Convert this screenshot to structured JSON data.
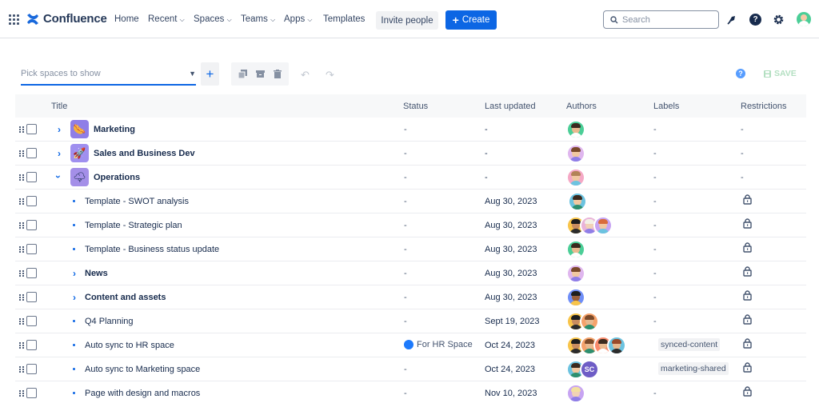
{
  "nav": {
    "app_name": "Confluence",
    "items": [
      {
        "label": "Home",
        "dropdown": false
      },
      {
        "label": "Recent",
        "dropdown": true
      },
      {
        "label": "Spaces",
        "dropdown": true
      },
      {
        "label": "Teams",
        "dropdown": true
      },
      {
        "label": "Apps",
        "dropdown": true
      },
      {
        "label": "Templates",
        "dropdown": false
      }
    ],
    "invite_label": "Invite people",
    "create_label": "Create",
    "search_placeholder": "Search",
    "icons": [
      "notification-icon",
      "help-icon",
      "settings-icon",
      "profile-avatar"
    ]
  },
  "toolbar": {
    "picker_placeholder": "Pick spaces to show",
    "save_label": "SAVE",
    "icons": [
      "add-icon",
      "copy-icon",
      "archive-icon",
      "trash-icon",
      "undo-icon",
      "redo-icon",
      "help-icon",
      "save-icon"
    ]
  },
  "table": {
    "columns": [
      "Title",
      "Status",
      "Last updated",
      "Authors",
      "Labels",
      "Restrictions"
    ],
    "rows": [
      {
        "title": "Marketing",
        "status": "-",
        "updated": "-",
        "labels": "-",
        "restrictions": "-"
      },
      {
        "title": "Sales and Business Dev",
        "status": "-",
        "updated": "-",
        "labels": "-",
        "restrictions": "-"
      },
      {
        "title": "Operations",
        "status": "-",
        "updated": "-",
        "labels": "-",
        "restrictions": "-"
      },
      {
        "title": "Template - SWOT analysis",
        "status": "-",
        "updated": "Aug 30, 2023",
        "labels": "-"
      },
      {
        "title": "Template - Strategic plan",
        "status": "-",
        "updated": "Aug 30, 2023",
        "labels": "-"
      },
      {
        "title": "Template - Business status update",
        "status": "-",
        "updated": "Aug 30, 2023",
        "labels": "-"
      },
      {
        "title": "News",
        "status": "-",
        "updated": "Aug 30, 2023",
        "labels": "-"
      },
      {
        "title": "Content and assets",
        "status": "-",
        "updated": "Aug 30, 2023",
        "labels": "-"
      },
      {
        "title": "Q4 Planning",
        "status": "-",
        "updated": "Sept 19, 2023",
        "labels": "-"
      },
      {
        "title": "Auto sync to HR space",
        "status": "For HR Space",
        "updated": "Oct 24, 2023",
        "labels": "synced-content"
      },
      {
        "title": "Auto sync to Marketing space",
        "status": "-",
        "updated": "Oct 24, 2023",
        "labels": "marketing-shared",
        "author_initials": "SC"
      },
      {
        "title": "Page with design and macros",
        "status": "-",
        "updated": "Nov 10, 2023",
        "labels": "-"
      }
    ]
  },
  "colors": {
    "brand": "#0c66e4",
    "status_dot": "#1d7afc",
    "space_icon": "#9e6bd8",
    "initials_avatar": "#6e5dc6"
  }
}
